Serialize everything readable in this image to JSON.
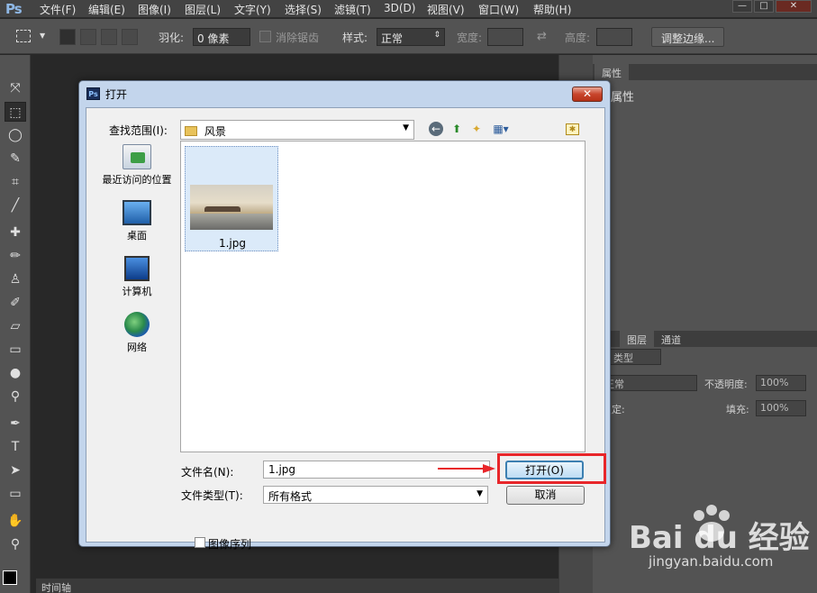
{
  "app": {
    "logo": "Ps"
  },
  "menu": [
    "文件(F)",
    "编辑(E)",
    "图像(I)",
    "图层(L)",
    "文字(Y)",
    "选择(S)",
    "滤镜(T)",
    "3D(D)",
    "视图(V)",
    "窗口(W)",
    "帮助(H)"
  ],
  "window_controls": {
    "minimize": "—",
    "maximize": "□",
    "close": "✕"
  },
  "options_bar": {
    "feather_label": "羽化:",
    "feather_value": "0 像素",
    "antialias_label": "消除锯齿",
    "style_label": "样式:",
    "style_value": "正常",
    "width_label": "宽度:",
    "height_label": "高度:",
    "refine_edge_button": "调整边缘..."
  },
  "panels": {
    "properties_tab": "属性",
    "properties_title": "属性",
    "layers_tab": "图层",
    "channels_tab": "通道",
    "kind_label": "类型",
    "blend_mode": "正常",
    "opacity_label": "不透明度:",
    "opacity_value": "100%",
    "lock_label": "锁定:",
    "fill_label": "填充:",
    "fill_value": "100%"
  },
  "timeline_tab": "时间轴",
  "dialog": {
    "title": "打开",
    "title_icon": "Ps",
    "look_in_label": "查找范围(I):",
    "look_in_value": "风景",
    "places": [
      {
        "label": "最近访问的位置",
        "icon": "recent-places-icon"
      },
      {
        "label": "桌面",
        "icon": "desktop-icon"
      },
      {
        "label": "计算机",
        "icon": "computer-icon"
      },
      {
        "label": "网络",
        "icon": "network-icon"
      }
    ],
    "files": [
      {
        "name": "1.jpg"
      }
    ],
    "file_name_label": "文件名(N):",
    "file_name_value": "1.jpg",
    "file_type_label": "文件类型(T):",
    "file_type_value": "所有格式",
    "open_button": "打开(O)",
    "cancel_button": "取消",
    "image_sequence_label": "图像序列"
  },
  "watermark": {
    "brand": "Bai du 经验",
    "url": "jingyan.baidu.com"
  },
  "colors": {
    "highlight": "#e8262a",
    "accent": "#3c7fb1",
    "ps_bg": "#282828"
  }
}
